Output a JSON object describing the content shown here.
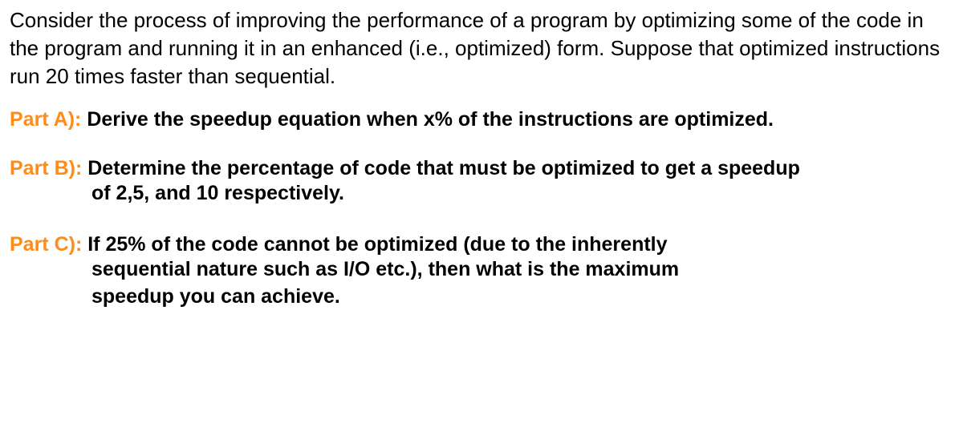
{
  "intro": "Consider the process of improving the performance of a program by optimizing some of the code in the program and running it in an enhanced (i.e., optimized) form. Suppose that optimized instructions run 20 times faster than sequential.",
  "partA": {
    "label": "Part A): ",
    "text": "Derive the speedup equation when x% of the instructions are optimized."
  },
  "partB": {
    "label": "Part B): ",
    "text": "Determine the percentage of code that must be optimized to get a speedup",
    "continuation": "of 2,5, and 10 respectively."
  },
  "partC": {
    "label": "Part C): ",
    "text": "If 25% of the code cannot be optimized (due to the inherently",
    "continuation1": "sequential nature such as I/O etc.), then what is the maximum",
    "continuation2": "speedup you can achieve."
  }
}
